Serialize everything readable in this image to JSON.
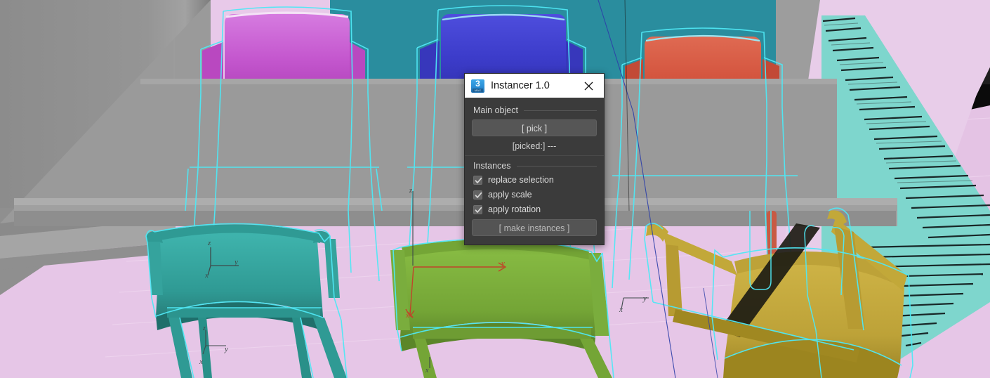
{
  "window": {
    "title": "Instancer 1.0",
    "icon": "3dsmax-app-icon",
    "icon_number": "3",
    "icon_sub": "MAX",
    "close_label": "✕",
    "title_bar_bg": "#ffffff",
    "body_bg": "#3b3b3b"
  },
  "sections": {
    "main_object": {
      "header": "Main object",
      "pick_button": "[ pick ]",
      "picked_status": "[picked:] ---"
    },
    "instances": {
      "header": "Instances",
      "options": [
        {
          "label": "replace selection",
          "checked": true
        },
        {
          "label": "apply scale",
          "checked": true
        },
        {
          "label": "apply rotation",
          "checked": true
        }
      ],
      "make_button": "[ make instances ]"
    }
  },
  "viewport": {
    "kind": "3d-viewport",
    "background_color": "#8f8f8f",
    "selection_outline_color": "#4fe8f5",
    "floor_color": "#e4c3e4",
    "wall_color": "#2a8d9e",
    "table_color": "#9a9a9a",
    "gizmo_axis_labels": [
      "z",
      "y",
      "x"
    ],
    "gizmo_color": "#4a4a4a",
    "active_gizmo_color": "#c0452a",
    "objects": [
      {
        "name": "chair-magenta",
        "color": "#c85ad0",
        "selected": true
      },
      {
        "name": "chair-blue",
        "color": "#4040cf",
        "selected": true
      },
      {
        "name": "chair-red",
        "color": "#d4553f",
        "selected": true
      },
      {
        "name": "chair-teal",
        "color": "#37a39e",
        "selected": true
      },
      {
        "name": "chair-green",
        "color": "#7aad3d",
        "selected": true
      },
      {
        "name": "chair-gold",
        "color": "#c2a839",
        "selected": true
      },
      {
        "name": "piano-keys-strip",
        "color": "#7fd8cf",
        "selected": false
      }
    ]
  }
}
